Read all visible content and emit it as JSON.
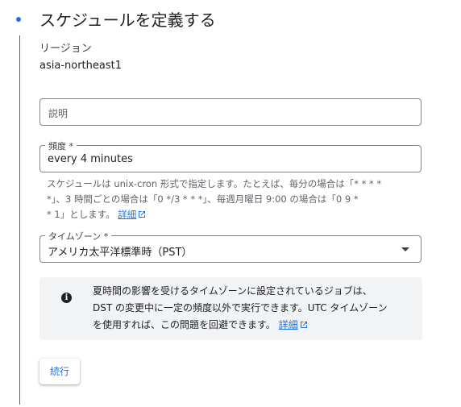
{
  "section": {
    "title": "スケジュールを定義する"
  },
  "region": {
    "label": "リージョン",
    "value": "asia-northeast1"
  },
  "description": {
    "placeholder": "説明"
  },
  "frequency": {
    "label": "頻度 *",
    "value": "every 4 minutes",
    "help_line1": "スケジュールは unix-cron 形式で指定します。たとえば、毎分の場合は「* * * *",
    "help_line2": "*」、3 時間ごとの場合は「0 */3 * * *」、毎週月曜日 9:00 の場合は「0 9 *",
    "help_line3": "* 1」とします。",
    "help_link": "詳細"
  },
  "timezone": {
    "label": "タイムゾーン *",
    "value": "アメリカ太平洋標準時（PST）"
  },
  "dst_notice": {
    "line1": "夏時間の影響を受けるタイムゾーンに設定されているジョブは、",
    "line2": "DST の変更中に一定の頻度以外で実行できます。UTC タイムゾーン",
    "line3": "を使用すれば、この問題を回避できます。",
    "link": "詳細"
  },
  "continue_button": {
    "label": "続行"
  },
  "icons": {
    "step": "step-bullet-icon",
    "dropdown": "arrow-drop-down-icon",
    "info": "info-icon",
    "external_link": "open-in-new-icon"
  },
  "colors": {
    "accent": "#1a73e8",
    "info_bg": "#f1f3f4"
  }
}
